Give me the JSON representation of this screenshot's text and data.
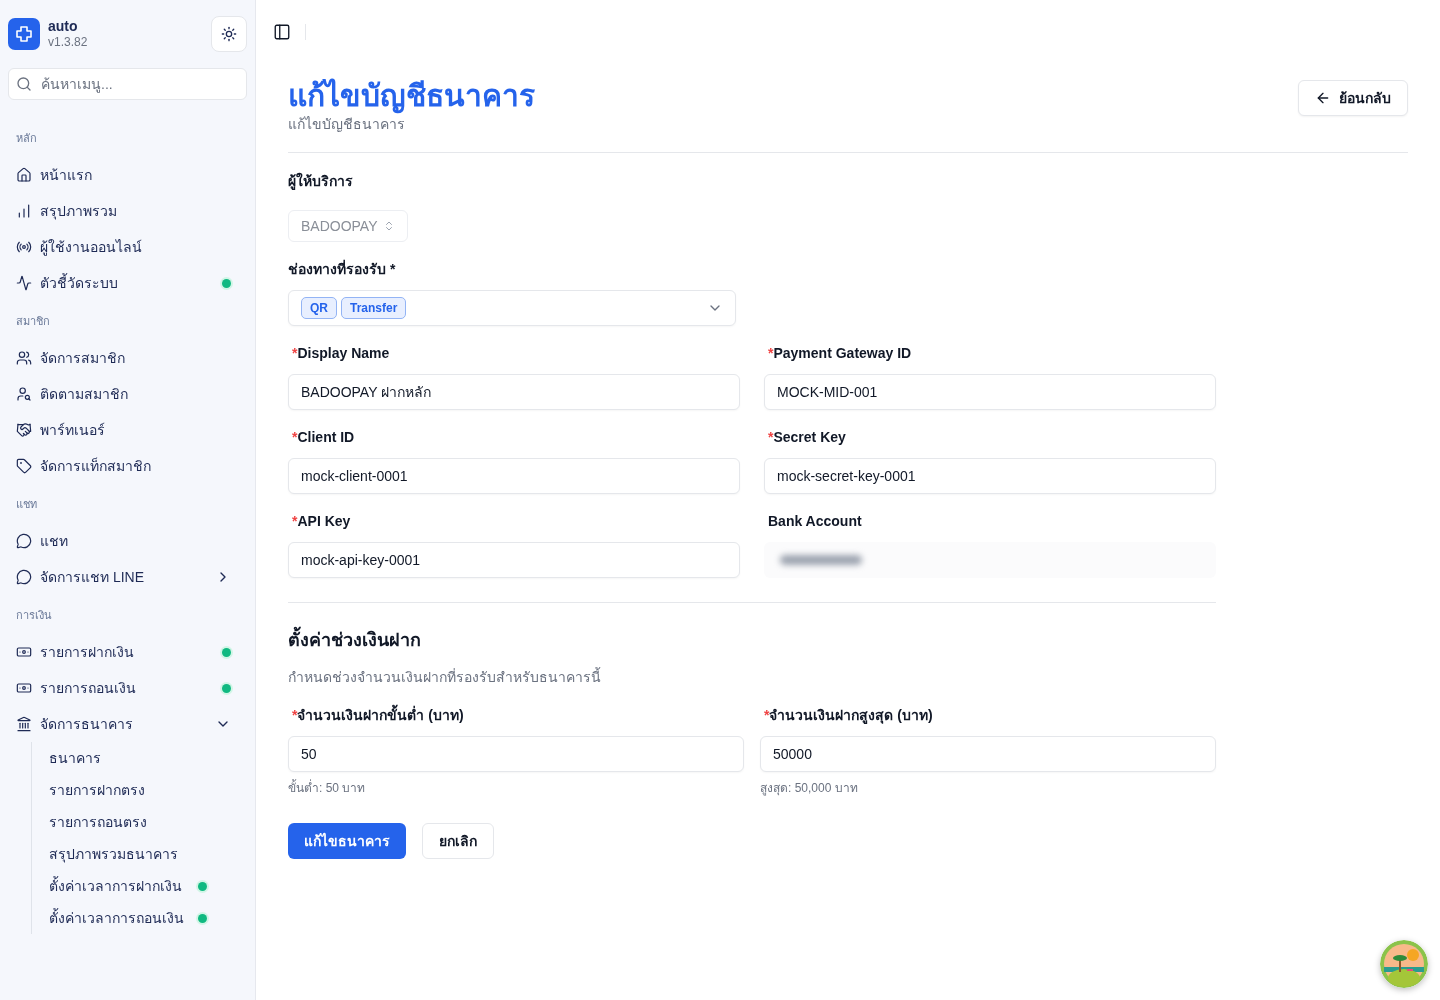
{
  "sidebar": {
    "app_name": "auto",
    "version": "v1.3.82",
    "search": {
      "placeholder": "ค้นหาเมนู..."
    },
    "sections": [
      {
        "title": "หลัก",
        "items": [
          {
            "kind": "link",
            "label": "หน้าแรก",
            "dot": false
          },
          {
            "kind": "link",
            "label": "สรุปภาพรวม",
            "dot": false
          },
          {
            "kind": "link",
            "label": "ผู้ใช้งานออนไลน์",
            "dot": false
          },
          {
            "kind": "link",
            "label": "ตัวชี้วัดระบบ",
            "dot": true
          }
        ]
      },
      {
        "title": "สมาชิก",
        "items": [
          {
            "kind": "link",
            "label": "จัดการสมาชิก",
            "dot": false
          },
          {
            "kind": "link",
            "label": "ติดตามสมาชิก",
            "dot": false
          },
          {
            "kind": "link",
            "label": "พาร์ทเนอร์",
            "dot": false
          },
          {
            "kind": "link",
            "label": "จัดการแท็กสมาชิก",
            "dot": false
          }
        ]
      },
      {
        "title": "แชท",
        "items": [
          {
            "kind": "link",
            "label": "แชท",
            "dot": false
          },
          {
            "kind": "group",
            "label": "จัดการแชท LINE",
            "dot": false,
            "expanded": false
          }
        ]
      },
      {
        "title": "การเงิน",
        "items": [
          {
            "kind": "link",
            "label": "รายการฝากเงิน",
            "dot": true
          },
          {
            "kind": "link",
            "label": "รายการถอนเงิน",
            "dot": true
          },
          {
            "kind": "group",
            "label": "จัดการธนาคาร",
            "dot": false,
            "expanded": true,
            "children": [
              {
                "label": "ธนาคาร",
                "dot": false
              },
              {
                "label": "รายการฝากตรง",
                "dot": false
              },
              {
                "label": "รายการถอนตรง",
                "dot": false
              },
              {
                "label": "สรุปภาพรวมธนาคาร",
                "dot": false
              },
              {
                "label": "ตั้งค่าเวลาการฝากเงิน",
                "dot": true
              },
              {
                "label": "ตั้งค่าเวลาการถอนเงิน",
                "dot": true
              }
            ]
          }
        ]
      }
    ]
  },
  "header": {
    "title": "แก้ไขบัญชีธนาคาร",
    "subtitle": "แก้ไขบัญชีธนาคาร",
    "back_button": "ย้อนกลับ"
  },
  "provider": {
    "label": "ผู้ให้บริการ",
    "value": "BADOOPAY",
    "disabled": true
  },
  "channels": {
    "label": "ช่องทางที่รองรับ *",
    "tags": [
      "QR",
      "Transfer"
    ]
  },
  "fields": [
    {
      "kind": "text",
      "required_mark": "*",
      "label": "Display Name",
      "value": "BADOOPAY ฝากหลัก"
    },
    {
      "kind": "text",
      "required_mark": "*",
      "label": "Payment Gateway ID",
      "value": "MOCK-MID-001"
    },
    {
      "kind": "text",
      "required_mark": "*",
      "label": "Client ID",
      "value": "mock-client-0001"
    },
    {
      "kind": "text",
      "required_mark": "*",
      "label": "Secret Key",
      "value": "mock-secret-key-0001"
    },
    {
      "kind": "text",
      "required_mark": "*",
      "label": "API Key",
      "value": "mock-api-key-0001"
    },
    {
      "kind": "blurred",
      "label": "Bank Account"
    }
  ],
  "deposit_range": {
    "title": "ตั้งค่าช่วงเงินฝาก",
    "description": "กำหนดช่วงจำนวนเงินฝากที่รองรับสำหรับธนาคารนี้",
    "fields": [
      {
        "required_mark": "*",
        "label": "จำนวนเงินฝากขั้นต่ำ (บาท)",
        "value": "50",
        "hint": "ขั้นต่ำ: 50 บาท"
      },
      {
        "required_mark": "*",
        "label": "จำนวนเงินฝากสูงสุด (บาท)",
        "value": "50000",
        "hint": "สูงสุด: 50,000 บาท"
      }
    ]
  },
  "actions": {
    "submit": "แก้ไขธนาคาร",
    "cancel": "ยกเลิก"
  }
}
